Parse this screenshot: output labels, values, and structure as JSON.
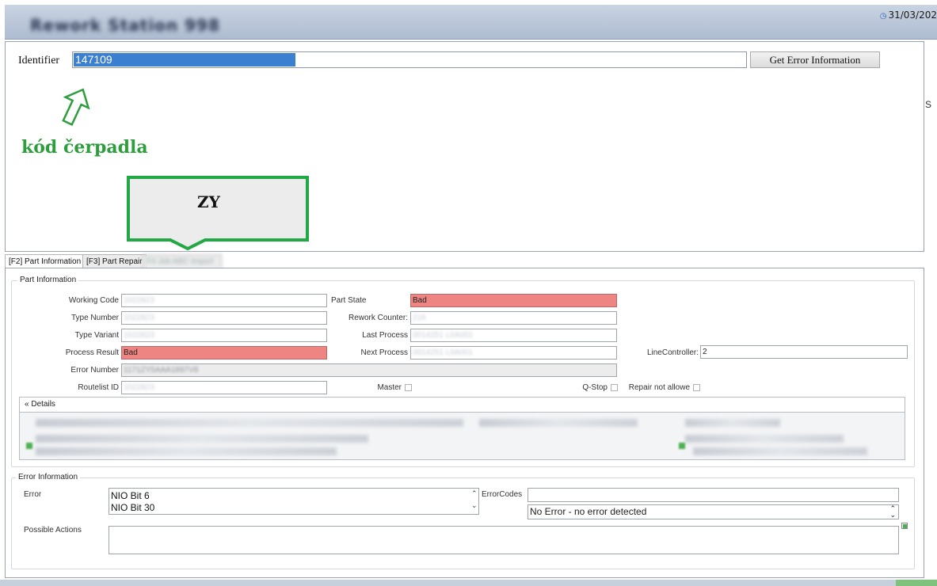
{
  "header": {
    "title": "Rework Station 998",
    "date": "31/03/202"
  },
  "identifier": {
    "label": "Identifier",
    "value": "147109",
    "button_label": "Get Error Information"
  },
  "annotations": {
    "arrow_caption": "kód čerpadla",
    "callout_text": "ZY",
    "side_char": "S",
    "accent_green": "#2e9e3c"
  },
  "tabs": [
    {
      "label": "[F2]  Part Information",
      "active": true
    },
    {
      "label": "[F3]  Part Repair",
      "active": false
    },
    {
      "label": "F4  Job ABC Import",
      "active": false
    }
  ],
  "part_info": {
    "group_title": "Part Information",
    "working_code": {
      "label": "Working Code",
      "value": "1022823"
    },
    "type_number": {
      "label": "Type Number",
      "value": "1022823"
    },
    "type_variant": {
      "label": "Type Variant",
      "value": "1022823"
    },
    "process_result": {
      "label": "Process Result",
      "value": "Bad"
    },
    "error_number": {
      "label": "Error Number",
      "value": "1171ZY5AAA1897V8"
    },
    "routelist_id": {
      "label": "Routelist ID",
      "value": "1022823"
    },
    "part_state": {
      "label": "Part State",
      "value": "Bad"
    },
    "rework_counter": {
      "label": "Rework Counter:",
      "value": "216"
    },
    "last_process": {
      "label": "Last Process",
      "value": "0014251 L0A001"
    },
    "next_process": {
      "label": "Next Process",
      "value": "0014251 L0A001"
    },
    "master": {
      "label": "Master"
    },
    "qstop": {
      "label": "Q-Stop"
    },
    "repair_not_allowed": {
      "label": "Repair not allowe"
    },
    "line_controller": {
      "label": "LineController:",
      "value": "2"
    },
    "details_label": "Details",
    "bad_color": "#ee8583"
  },
  "error_info": {
    "group_title": "Error Information",
    "error_label": "Error",
    "errors": [
      "NIO Bit 6",
      "NIO Bit 30"
    ],
    "error_codes_label": "ErrorCodes",
    "error_codes_value": "",
    "no_error_value": "No  Error - no error detected",
    "possible_actions_label": "Possible Actions",
    "possible_actions_value": ""
  }
}
